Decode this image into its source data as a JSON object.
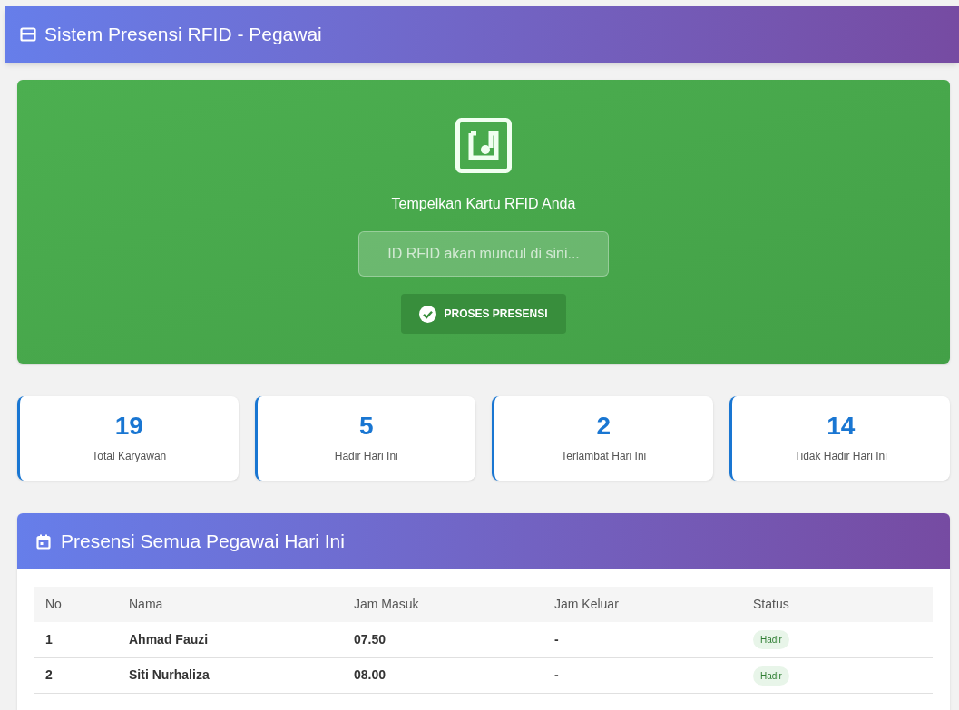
{
  "header": {
    "title": "Sistem Presensi RFID - Pegawai"
  },
  "scanner": {
    "prompt": "Tempelkan Kartu RFID Anda",
    "placeholder": "ID RFID akan muncul di sini...",
    "button": "PROSES PRESENSI"
  },
  "stats": [
    {
      "value": "19",
      "label": "Total Karyawan"
    },
    {
      "value": "5",
      "label": "Hadir Hari Ini"
    },
    {
      "value": "2",
      "label": "Terlambat Hari Ini"
    },
    {
      "value": "14",
      "label": "Tidak Hadir Hari Ini"
    }
  ],
  "attendance": {
    "title": "Presensi Semua Pegawai Hari Ini",
    "columns": [
      "No",
      "Nama",
      "Jam Masuk",
      "Jam Keluar",
      "Status"
    ],
    "rows": [
      {
        "no": "1",
        "name": "Ahmad Fauzi",
        "in": "07.50",
        "out": "-",
        "status": "Hadir",
        "kind": "present"
      },
      {
        "no": "2",
        "name": "Siti Nurhaliza",
        "in": "08.00",
        "out": "-",
        "status": "Hadir",
        "kind": "present"
      }
    ]
  }
}
